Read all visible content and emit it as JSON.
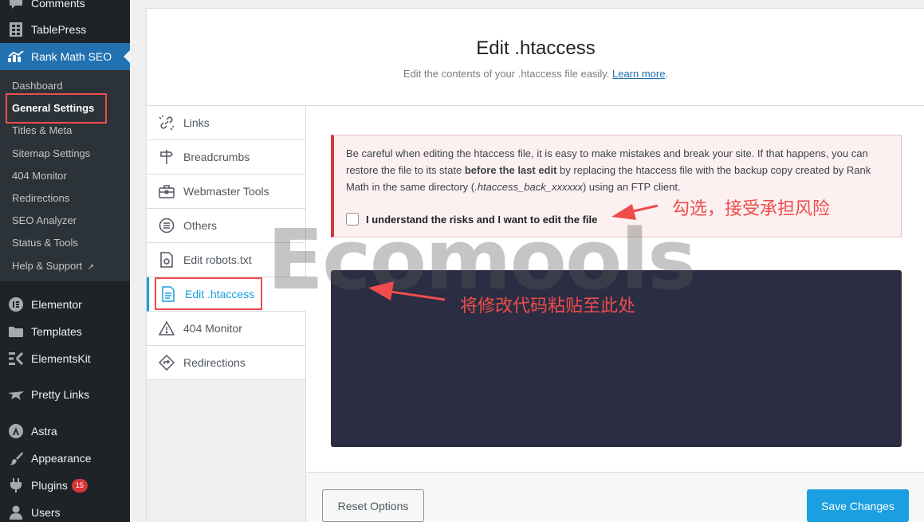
{
  "admin_menu": {
    "items_top": [
      {
        "label": "Comments",
        "icon": "comment-bubble-icon"
      },
      {
        "label": "TablePress",
        "icon": "table-icon"
      },
      {
        "label": "Rank Math SEO",
        "icon": "rank-math-icon"
      }
    ],
    "submenu": [
      {
        "label": "Dashboard"
      },
      {
        "label": "General Settings"
      },
      {
        "label": "Titles & Meta"
      },
      {
        "label": "Sitemap Settings"
      },
      {
        "label": "404 Monitor"
      },
      {
        "label": "Redirections"
      },
      {
        "label": "SEO Analyzer"
      },
      {
        "label": "Status & Tools"
      },
      {
        "label": "Help & Support"
      }
    ],
    "items_bottom": [
      {
        "label": "Elementor",
        "icon": "elementor-icon"
      },
      {
        "label": "Templates",
        "icon": "folder-icon"
      },
      {
        "label": "ElementsKit",
        "icon": "elementskit-icon"
      },
      {
        "label": "Pretty Links",
        "icon": "star-icon"
      },
      {
        "label": "Astra",
        "icon": "astra-icon"
      },
      {
        "label": "Appearance",
        "icon": "paintbrush-icon"
      },
      {
        "label": "Plugins",
        "icon": "plug-icon",
        "badge": "15"
      },
      {
        "label": "Users",
        "icon": "user-icon"
      }
    ]
  },
  "header": {
    "title": "Edit .htaccess",
    "description": "Edit the contents of your .htaccess file easily.",
    "learn_more": "Learn more"
  },
  "tabs": [
    {
      "label": "Links",
      "icon": "link-icon"
    },
    {
      "label": "Breadcrumbs",
      "icon": "signpost-icon"
    },
    {
      "label": "Webmaster Tools",
      "icon": "toolbox-icon"
    },
    {
      "label": "Others",
      "icon": "list-circle-icon"
    },
    {
      "label": "Edit robots.txt",
      "icon": "file-robot-icon"
    },
    {
      "label": "Edit .htaccess",
      "icon": "file-text-icon",
      "active": true
    },
    {
      "label": "404 Monitor",
      "icon": "warning-icon"
    },
    {
      "label": "Redirections",
      "icon": "redirect-icon"
    }
  ],
  "notice": {
    "part1": "Be careful when editing the htaccess file, it is easy to make mistakes and break your site. If that happens, you can restore the file to its state ",
    "bold": "before the last edit",
    "part2": " by replacing the htaccess file with the backup copy created by Rank Math in the same directory (",
    "italic": ".htaccess_back_xxxxxx",
    "part3": ") using an FTP client.",
    "checkbox_label": "I understand the risks and I want to edit the file"
  },
  "footer": {
    "reset_label": "Reset Options",
    "save_label": "Save Changes"
  },
  "annotations": {
    "check_note": "勾选，接受承担风险",
    "paste_note": "将修改代码粘贴至此处",
    "watermark": "Ecomools"
  },
  "colors": {
    "admin_bg": "#1d2327",
    "submenu_bg": "#2c3338",
    "wp_blue": "#2271b1",
    "rank_math_blue": "#1a9fe0",
    "notice_red": "#d63638",
    "code_bg": "#2b2d42",
    "annotation_red": "#ef4c4c"
  }
}
